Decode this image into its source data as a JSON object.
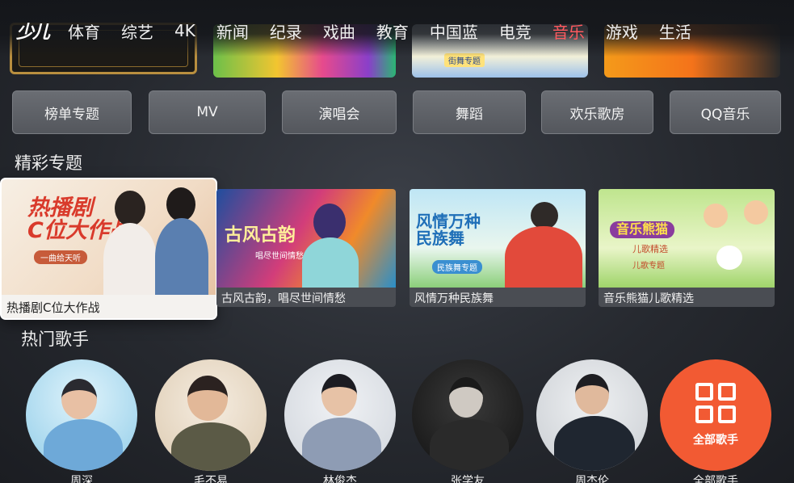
{
  "nav": {
    "logo": "少儿",
    "items": [
      {
        "label": "体育"
      },
      {
        "label": "综艺"
      },
      {
        "label": "4K"
      },
      {
        "label": "新闻"
      },
      {
        "label": "纪录"
      },
      {
        "label": "戏曲"
      },
      {
        "label": "教育"
      },
      {
        "label": "中国蓝"
      },
      {
        "label": "电竞"
      },
      {
        "label": "音乐",
        "active": true
      },
      {
        "label": "游戏"
      },
      {
        "label": "生活"
      }
    ],
    "active_color": "#ff5a5f"
  },
  "top_thumbs": {
    "tag": "街舞专题"
  },
  "categories": [
    {
      "label": "榜单专题"
    },
    {
      "label": "MV"
    },
    {
      "label": "演唱会"
    },
    {
      "label": "舞蹈"
    },
    {
      "label": "欢乐歌房"
    },
    {
      "label": "QQ音乐"
    }
  ],
  "featured": {
    "title": "精彩专题",
    "cards": [
      {
        "caption": "热播剧C位大作战",
        "art_title": "热播剧\nC位大作战",
        "art_sub": "一曲给天听",
        "focused": true
      },
      {
        "caption": "古风古韵，唱尽世间情愁",
        "art_title": "古风古韵",
        "art_sub": "唱尽世间情愁"
      },
      {
        "caption": "风情万种民族舞",
        "art_title": "风情万种\n民族舞",
        "art_sub": "民族舞专题"
      },
      {
        "caption": "音乐熊猫儿歌精选",
        "art_title": "音乐熊猫",
        "art_sub": "儿歌精选",
        "art_tag": "儿歌专题"
      }
    ]
  },
  "singers": {
    "title": "热门歌手",
    "items": [
      {
        "name": "周深"
      },
      {
        "name": "毛不易"
      },
      {
        "name": "林俊杰"
      },
      {
        "name": "张学友"
      },
      {
        "name": "周杰伦"
      }
    ],
    "all_label": "全部歌手",
    "all_caption": "全部歌手",
    "all_color": "#f25a33"
  }
}
